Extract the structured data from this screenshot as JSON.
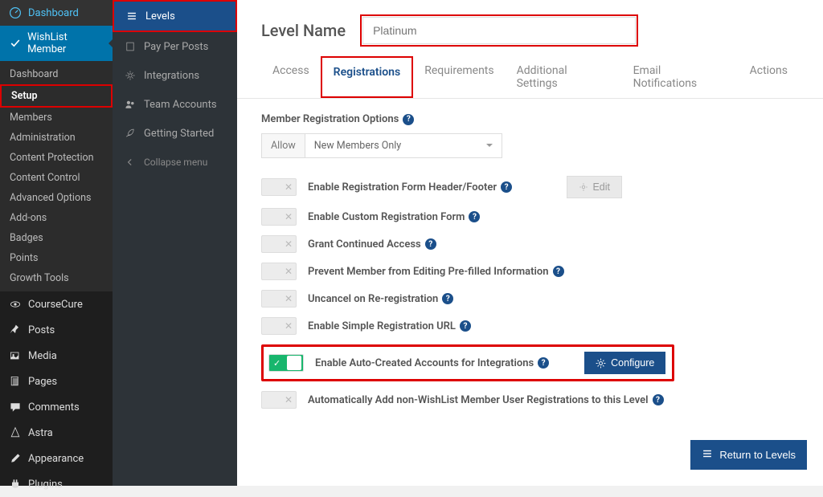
{
  "wp_sidebar": {
    "items": [
      {
        "label": "Dashboard"
      },
      {
        "label": "WishList Member"
      }
    ],
    "sub": [
      {
        "label": "Dashboard"
      },
      {
        "label": "Setup"
      },
      {
        "label": "Members"
      },
      {
        "label": "Administration"
      },
      {
        "label": "Content Protection"
      },
      {
        "label": "Content Control"
      },
      {
        "label": "Advanced Options"
      },
      {
        "label": "Add-ons"
      },
      {
        "label": "Badges"
      },
      {
        "label": "Points"
      },
      {
        "label": "Growth Tools"
      }
    ],
    "items2": [
      {
        "label": "CourseCure"
      },
      {
        "label": "Posts"
      },
      {
        "label": "Media"
      },
      {
        "label": "Pages"
      },
      {
        "label": "Comments"
      },
      {
        "label": "Astra"
      },
      {
        "label": "Appearance"
      },
      {
        "label": "Plugins"
      }
    ]
  },
  "sub_sidebar": {
    "items": [
      {
        "label": "Levels"
      },
      {
        "label": "Pay Per Posts"
      },
      {
        "label": "Integrations"
      },
      {
        "label": "Team Accounts"
      },
      {
        "label": "Getting Started"
      },
      {
        "label": "Collapse menu"
      }
    ]
  },
  "main": {
    "title": "Level Name",
    "input_placeholder": "Platinum",
    "tabs": [
      {
        "label": "Access"
      },
      {
        "label": "Registrations"
      },
      {
        "label": "Requirements"
      },
      {
        "label": "Additional Settings"
      },
      {
        "label": "Email Notifications"
      },
      {
        "label": "Actions"
      }
    ],
    "section_title": "Member Registration Options",
    "allow_label": "Allow",
    "allow_value": "New Members Only",
    "options": [
      {
        "label": "Enable Registration Form Header/Footer",
        "on": false,
        "edit": true
      },
      {
        "label": "Enable Custom Registration Form",
        "on": false
      },
      {
        "label": "Grant Continued Access",
        "on": false
      },
      {
        "label": "Prevent Member from Editing Pre-filled Information",
        "on": false
      },
      {
        "label": "Uncancel on Re-registration",
        "on": false
      },
      {
        "label": "Enable Simple Registration URL",
        "on": false
      },
      {
        "label": "Enable Auto-Created Accounts for Integrations",
        "on": true,
        "configure": true,
        "highlight": true
      },
      {
        "label": "Automatically Add non-WishList Member User Registrations to this Level",
        "on": false
      }
    ],
    "edit_label": "Edit",
    "configure_label": "Configure",
    "return_label": "Return to Levels"
  }
}
